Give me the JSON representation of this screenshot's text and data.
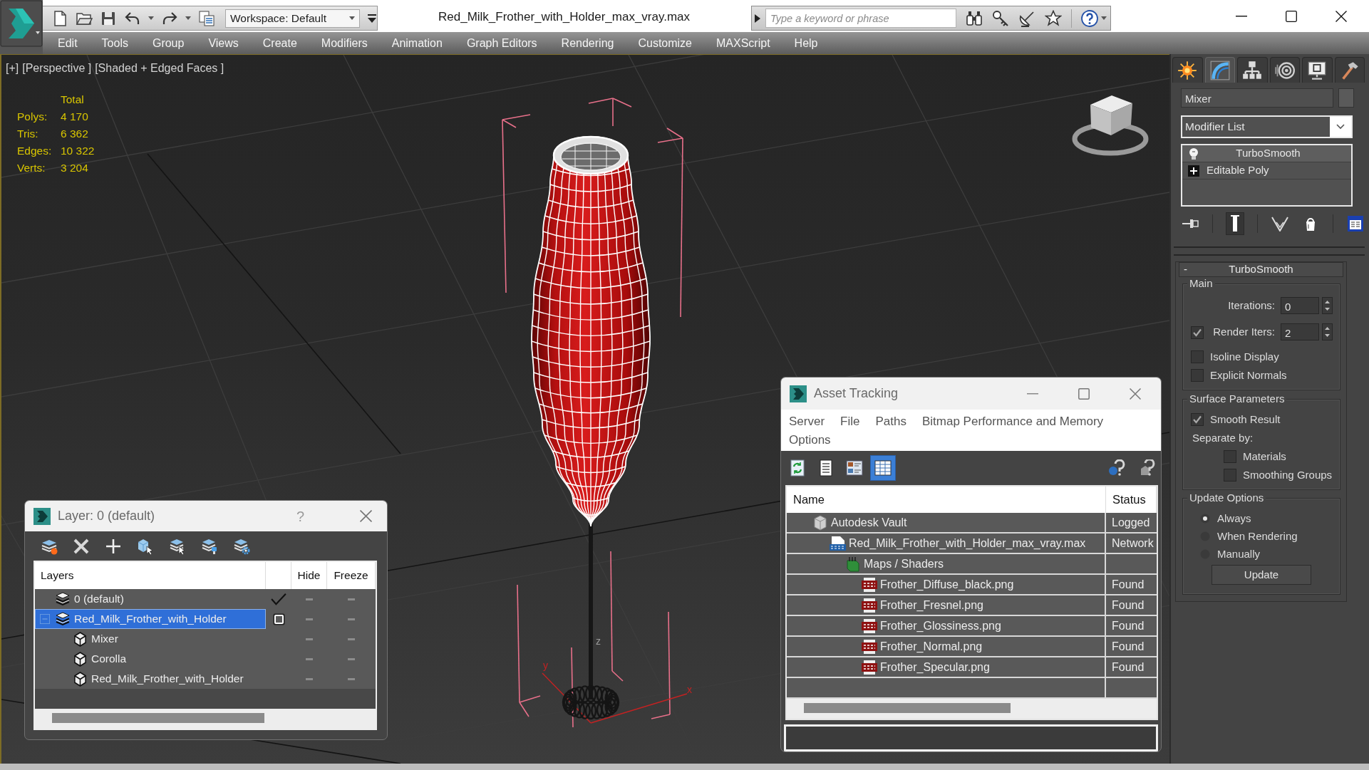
{
  "app": {
    "title": "Red_Milk_Frother_with_Holder_max_vray.max",
    "workspace": "Workspace: Default",
    "search": {
      "placeholder": "Type a keyword or phrase"
    }
  },
  "menu": [
    "Edit",
    "Tools",
    "Group",
    "Views",
    "Create",
    "Modifiers",
    "Animation",
    "Graph Editors",
    "Rendering",
    "Customize",
    "MAXScript",
    "Help"
  ],
  "viewport": {
    "labels": [
      "[+]",
      "[Perspective ]",
      "[Shaded + Edged Faces ]"
    ],
    "stats": {
      "header": "Total",
      "rows": [
        {
          "label": "Polys:",
          "value": "4 170"
        },
        {
          "label": "Tris:",
          "value": "6 362"
        },
        {
          "label": "Edges:",
          "value": "10 322"
        },
        {
          "label": "Verts:",
          "value": "3 204"
        }
      ]
    },
    "axis_labels": [
      "z",
      "y",
      "x"
    ]
  },
  "command_panel": {
    "tabs": [
      {
        "kind": "create",
        "selected": false
      },
      {
        "kind": "modify",
        "selected": true
      },
      {
        "kind": "hierarchy",
        "selected": false
      },
      {
        "kind": "motion",
        "selected": false
      },
      {
        "kind": "display",
        "selected": false
      },
      {
        "kind": "utilities",
        "selected": false
      }
    ],
    "object_name": "Mixer",
    "modifier_list": "Modifier List",
    "stack": [
      {
        "label": "TurboSmooth",
        "kind": "modifier",
        "selected": true
      },
      {
        "label": "Editable Poly",
        "kind": "base",
        "selected": false
      }
    ],
    "stack_tools": [
      {
        "kind": "pin",
        "on": false
      },
      {
        "kind": "show_end",
        "on": true
      },
      {
        "kind": "unique",
        "on": false
      },
      {
        "kind": "remove",
        "on": false
      },
      {
        "kind": "configure",
        "on": false
      }
    ],
    "rollout": {
      "toggle": "-",
      "title": "TurboSmooth",
      "groups": [
        {
          "title": "Main",
          "controls": [
            {
              "kind": "spinner",
              "label": "Iterations:",
              "value": "0"
            },
            {
              "kind": "spinner",
              "label": "Render Iters:",
              "value": "2",
              "checked": true
            },
            {
              "kind": "checkbox",
              "label": "Isoline Display",
              "checked": false
            },
            {
              "kind": "checkbox",
              "label": "Explicit Normals",
              "checked": false
            }
          ]
        },
        {
          "title": "Surface Parameters",
          "controls": [
            {
              "kind": "checkbox",
              "label": "Smooth Result",
              "checked": true
            },
            {
              "kind": "text",
              "label": "Separate by:"
            },
            {
              "kind": "subcheckbox",
              "label": "Materials",
              "checked": false
            },
            {
              "kind": "subcheckbox",
              "label": "Smoothing Groups",
              "checked": false
            }
          ]
        },
        {
          "title": "Update Options",
          "controls": [
            {
              "kind": "radio",
              "label": "Always",
              "selected": true
            },
            {
              "kind": "radio",
              "label": "When Rendering",
              "selected": false
            },
            {
              "kind": "radio",
              "label": "Manually",
              "selected": false
            },
            {
              "kind": "button",
              "label": "Update"
            }
          ]
        }
      ]
    }
  },
  "layer_dialog": {
    "title": "Layer: 0 (default)",
    "help": "?",
    "columns": [
      "Layers",
      "Hide",
      "Freeze"
    ],
    "rows": [
      {
        "name": "0 (default)",
        "kind": "layer",
        "selected": false,
        "current": true,
        "hidden": false,
        "frozen": false
      },
      {
        "name": "Red_Milk_Frother_with_Holder",
        "kind": "layer",
        "selected": true,
        "current": false,
        "expanded": true,
        "hidden": false,
        "frozen": false,
        "children": [
          {
            "name": "Mixer",
            "kind": "object",
            "selected": false,
            "hidden": false,
            "frozen": false
          },
          {
            "name": "Corolla",
            "kind": "object",
            "selected": false,
            "hidden": false,
            "frozen": false
          },
          {
            "name": "Red_Milk_Frother_with_Holder",
            "kind": "object",
            "selected": false,
            "hidden": false,
            "frozen": false
          }
        ]
      }
    ]
  },
  "asset_tracking": {
    "title": "Asset Tracking",
    "menu": [
      "Server",
      "File",
      "Paths",
      "Bitmap Performance and Memory",
      "Options"
    ],
    "toolbar": [
      {
        "kind": "refresh",
        "selected": false
      },
      {
        "kind": "list",
        "selected": false
      },
      {
        "kind": "thumbnails",
        "selected": false
      },
      {
        "kind": "table",
        "selected": true
      }
    ],
    "columns": [
      "Name",
      "Status"
    ],
    "rows": [
      {
        "name": "Autodesk Vault",
        "kind": "vault",
        "status": "Logged",
        "selected": false,
        "children": [
          {
            "name": "Red_Milk_Frother_with_Holder_max_vray.max",
            "kind": "max",
            "status": "Network",
            "selected": false,
            "children": [
              {
                "name": "Maps / Shaders",
                "kind": "folder",
                "selected": false,
                "children": [
                  {
                    "name": "Frother_Diffuse_black.png",
                    "kind": "png",
                    "status": "Found",
                    "selected": false
                  },
                  {
                    "name": "Frother_Fresnel.png",
                    "kind": "png",
                    "status": "Found",
                    "selected": false
                  },
                  {
                    "name": "Frother_Glossiness.png",
                    "kind": "png",
                    "status": "Found",
                    "selected": false
                  },
                  {
                    "name": "Frother_Normal.png",
                    "kind": "png",
                    "status": "Found",
                    "selected": false
                  },
                  {
                    "name": "Frother_Specular.png",
                    "kind": "png",
                    "status": "Found",
                    "selected": false
                  }
                ]
              }
            ]
          }
        ]
      }
    ]
  }
}
